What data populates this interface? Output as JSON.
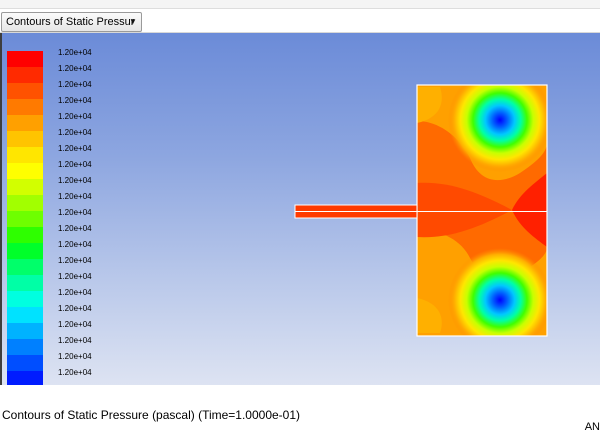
{
  "toolbar": {
    "display_select_value": "Contours of Static Pressur"
  },
  "legend": {
    "colors": [
      "#ff0000",
      "#ff2a00",
      "#ff5200",
      "#ff7a00",
      "#ffa000",
      "#ffc400",
      "#ffe600",
      "#ffff00",
      "#d2ff00",
      "#a2ff00",
      "#6eff00",
      "#2eff00",
      "#00ff2a",
      "#00ff6a",
      "#00ffa6",
      "#00ffe0",
      "#00e2ff",
      "#00b2ff",
      "#0080ff",
      "#004eff",
      "#001cff",
      "#0000ff"
    ],
    "labels": [
      "1.20e+04",
      "1.20e+04",
      "1.20e+04",
      "1.20e+04",
      "1.20e+04",
      "1.20e+04",
      "1.20e+04",
      "1.20e+04",
      "1.20e+04",
      "1.20e+04",
      "1.20e+04",
      "1.20e+04",
      "1.20e+04",
      "1.20e+04",
      "1.20e+04",
      "1.20e+04",
      "1.20e+04",
      "1.20e+04",
      "1.20e+04",
      "1.20e+04",
      "1.20e+04",
      "1.20e+04"
    ]
  },
  "footer": {
    "caption": "Contours of Static Pressure (pascal)  (Time=1.0000e-01)",
    "vendor_mark": "AN"
  }
}
